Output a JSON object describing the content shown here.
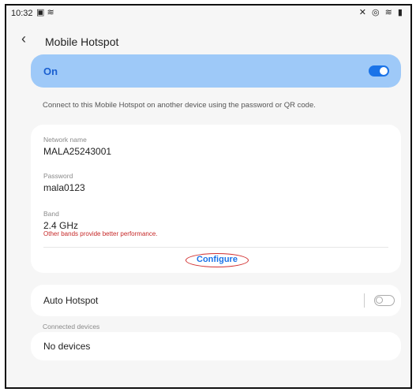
{
  "status_bar": {
    "time": "10:32",
    "left_icons": "▣ ≋",
    "right_icons": "✕ ◎ ≋ ▮"
  },
  "header": {
    "back_icon": "‹",
    "title": "Mobile Hotspot"
  },
  "hotspot_toggle": {
    "label": "On",
    "state": "on"
  },
  "description": "Connect to this Mobile Hotspot on another device using the password or QR code.",
  "settings_card": {
    "network_name_label": "Network name",
    "network_name_value": "MALA25243001",
    "password_label": "Password",
    "password_value": "mala0123",
    "band_label": "Band",
    "band_value": "2.4 GHz",
    "band_warning": "Other bands provide better performance.",
    "configure_label": "Configure"
  },
  "auto_hotspot": {
    "label": "Auto Hotspot",
    "state": "off"
  },
  "connected_devices": {
    "section_label": "Connected devices",
    "empty_label": "No devices"
  },
  "colors": {
    "accent": "#1a73e8",
    "on_bar": "#9ec9f8",
    "warning": "#c62828",
    "highlight_ring": "#d23030"
  }
}
